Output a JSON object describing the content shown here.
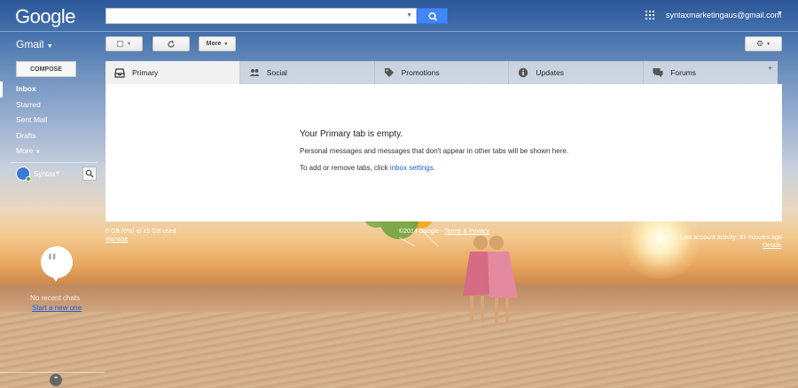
{
  "header": {
    "logo": "Google",
    "search": {
      "value": "",
      "placeholder": ""
    },
    "account_email": "syntaxmarketingaus@gmail.com"
  },
  "toolbar": {
    "app_label": "Gmail",
    "more_label": "More"
  },
  "sidebar": {
    "compose_label": "COMPOSE",
    "items": [
      {
        "label": "Inbox",
        "active": true
      },
      {
        "label": "Starred"
      },
      {
        "label": "Sent Mail"
      },
      {
        "label": "Drafts"
      },
      {
        "label": "More"
      }
    ],
    "user_name": "Syntax",
    "hangouts": {
      "no_recent": "No recent chats",
      "start_new": "Start a new one"
    }
  },
  "tabs": [
    {
      "label": "Primary",
      "icon": "inbox-icon",
      "active": true
    },
    {
      "label": "Social",
      "icon": "people-icon"
    },
    {
      "label": "Promotions",
      "icon": "tag-icon"
    },
    {
      "label": "Updates",
      "icon": "info-icon"
    },
    {
      "label": "Forums",
      "icon": "forum-icon"
    }
  ],
  "main": {
    "empty_title": "Your Primary tab is empty.",
    "empty_line1": "Personal messages and messages that don't appear in other tabs will be shown here.",
    "empty_line2_prefix": "To add or remove tabs, click ",
    "empty_line2_link": "inbox settings",
    "empty_line2_suffix": "."
  },
  "footer": {
    "storage": "0 GB (0%) of 15 GB used",
    "manage": "Manage",
    "copyright": "©2014 Google - ",
    "terms": "Terms & Privacy",
    "activity": "Last account activity: 31 minutes ago",
    "details": "Details"
  },
  "colors": {
    "accent": "#4285f4",
    "link": "#1a5fd3"
  }
}
